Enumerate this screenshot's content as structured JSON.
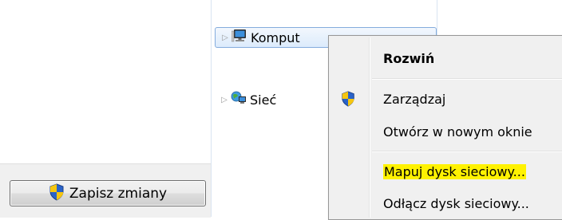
{
  "settings_panel": {
    "save_button_label": "Zapisz zmiany",
    "save_button_icon": "uac-shield-icon"
  },
  "nav_tree": {
    "items": [
      {
        "label": "Komput",
        "icon": "computer-icon",
        "expander": "▷",
        "selected": true
      },
      {
        "label": "Sieć",
        "icon": "network-icon",
        "expander": "▷",
        "selected": false
      }
    ]
  },
  "context_menu": {
    "items": [
      {
        "label": "Rozwiń",
        "bold": true,
        "icon": null
      },
      {
        "label": "Zarządzaj",
        "bold": false,
        "icon": "uac-shield-icon"
      },
      {
        "label": "Otwórz w nowym oknie",
        "bold": false,
        "icon": null
      },
      {
        "label": "Mapuj dysk sieciowy...",
        "bold": false,
        "icon": null,
        "highlighted": true
      },
      {
        "label": "Odłącz dysk sieciowy...",
        "bold": false,
        "icon": null
      }
    ]
  },
  "colors": {
    "selection_border": "#84acdd",
    "highlight": "#fff200",
    "menu_background": "#f0f0f0",
    "shield_blue": "#2a63c9",
    "shield_yellow": "#f6c60f"
  }
}
